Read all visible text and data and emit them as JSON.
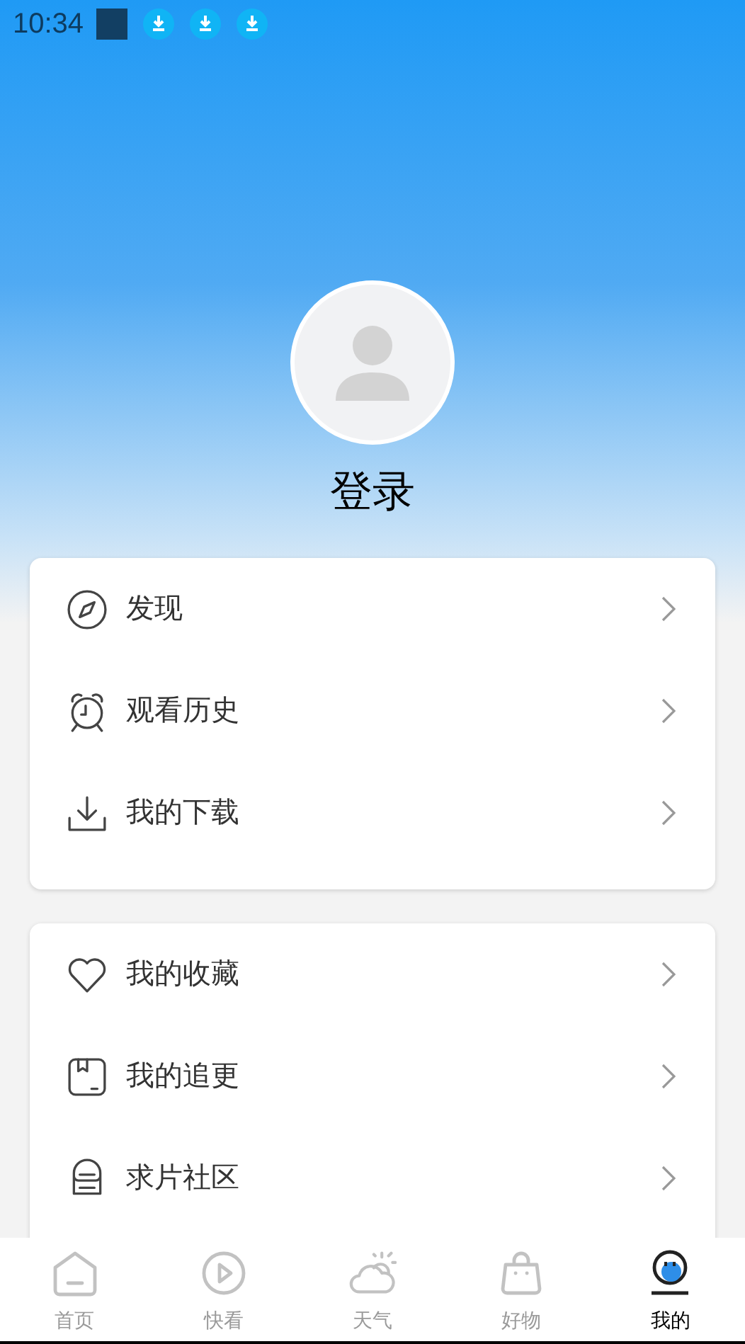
{
  "status_bar": {
    "time": "10:34"
  },
  "profile": {
    "login": "登录"
  },
  "menu_groups": [
    {
      "items": [
        {
          "label": "发现"
        },
        {
          "label": "观看历史"
        },
        {
          "label": "我的下载"
        }
      ]
    },
    {
      "items": [
        {
          "label": "我的收藏"
        },
        {
          "label": "我的追更"
        },
        {
          "label": "求片社区"
        }
      ]
    }
  ],
  "tab_bar": [
    {
      "label": "首页",
      "selected": false
    },
    {
      "label": "快看",
      "selected": false
    },
    {
      "label": "天气",
      "selected": false
    },
    {
      "label": "好物",
      "selected": false
    },
    {
      "label": "我的",
      "selected": true
    }
  ]
}
